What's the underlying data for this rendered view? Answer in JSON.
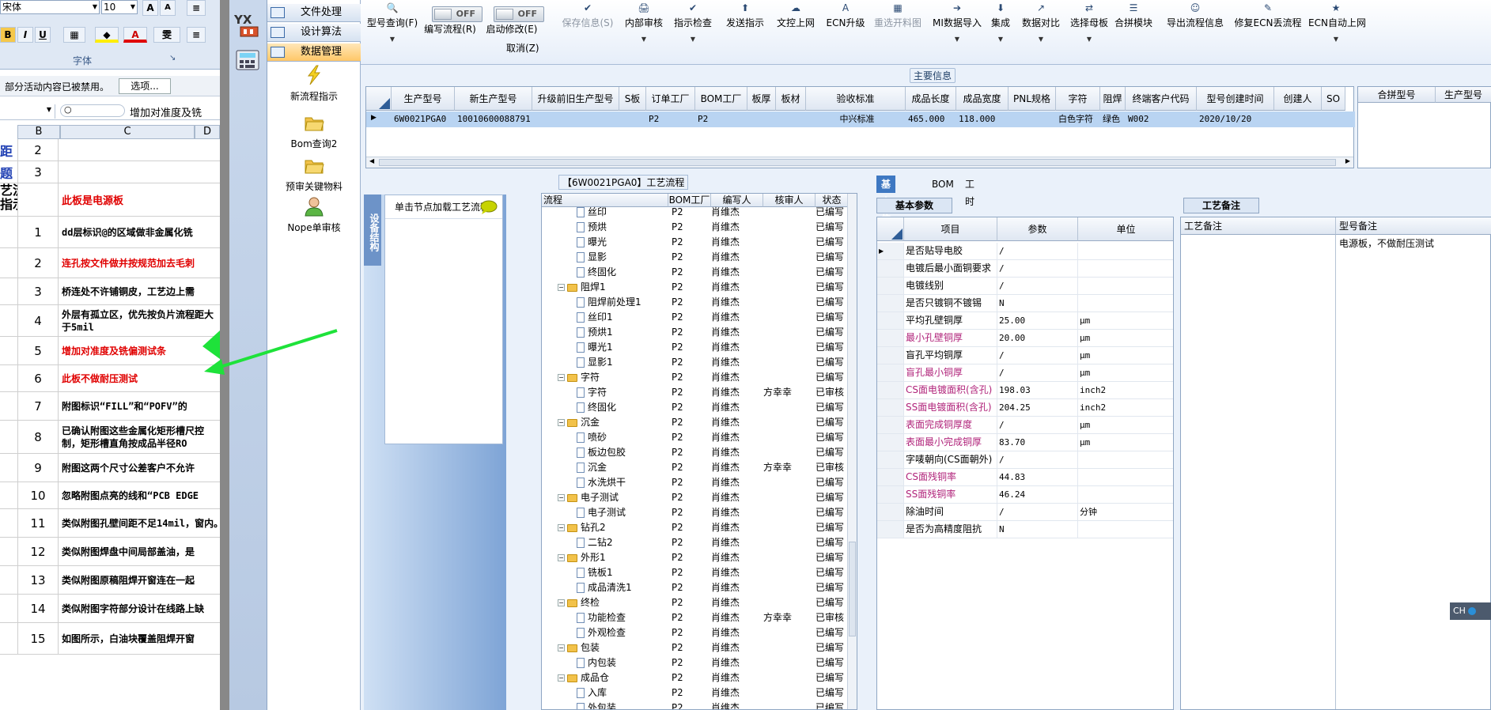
{
  "excel": {
    "font_name": "宋体",
    "font_size": "10",
    "font_group_label": "字体",
    "message": "部分活动内容已被禁用。",
    "options_button": "选项...",
    "formula_text": "增加对准度及铣",
    "col_b": "B",
    "col_c": "C",
    "col_d": "D",
    "left_fragments": [
      "距",
      "题",
      "艺流程",
      "指示"
    ],
    "rows": [
      {
        "num": "2",
        "text": "",
        "red": false
      },
      {
        "num": "3",
        "text": "",
        "red": false
      },
      {
        "num": "",
        "text": "此板是电源板",
        "red": true
      },
      {
        "num": "1",
        "text": "dd层标识@的区域做非金属化铣",
        "red": false
      },
      {
        "num": "2",
        "text": "连孔按文件做并按规范加去毛刺",
        "red": true
      },
      {
        "num": "3",
        "text": "桥连处不许铺铜皮，工艺边上需",
        "red": false
      },
      {
        "num": "4",
        "text": "外层有孤立区，优先按负片流程距大于5mil",
        "red": false
      },
      {
        "num": "5",
        "text": "增加对准度及铣偏测试条",
        "red": true
      },
      {
        "num": "6",
        "text": "此板不做耐压测试",
        "red": true
      },
      {
        "num": "7",
        "text": "附图标识“FILL”和“POFV”的",
        "red": false
      },
      {
        "num": "8",
        "text": "已确认附图这些金属化矩形槽尺控制，矩形槽直角按成品半径RO",
        "red": false
      },
      {
        "num": "9",
        "text": "附图这两个尺寸公差客户不允许",
        "red": false
      },
      {
        "num": "10",
        "text": "忽略附图点亮的线和“PCB EDGE",
        "red": false
      },
      {
        "num": "11",
        "text": "类似附图孔壁间距不足14mil，窗内。",
        "red": false
      },
      {
        "num": "12",
        "text": "类似附图焊盘中间局部盖油，是",
        "red": false
      },
      {
        "num": "13",
        "text": "类似附图原稿阻焊开窗连在一起",
        "red": false
      },
      {
        "num": "14",
        "text": "类似附图字符部分设计在线路上缺",
        "red": false
      },
      {
        "num": "15",
        "text": "如图所示，白油块覆盖阻焊开窗",
        "red": false
      }
    ]
  },
  "modules": {
    "logo": "YX",
    "tabs": [
      "文件处理",
      "设计算法",
      "数据管理"
    ],
    "tools": [
      "新流程指示",
      "Bom查询2",
      "预审关键物料",
      "Nope单审核"
    ]
  },
  "toolbar": {
    "buttons": [
      {
        "label": "型号查询(F)",
        "icon": "🔍",
        "disabled": false,
        "dd": true
      },
      {
        "label": "编写流程(R)",
        "icon": "",
        "disabled": false,
        "dd": false
      },
      {
        "label": "启动修改(E)",
        "icon": "",
        "disabled": false,
        "dd": false
      },
      {
        "label": "保存信息(S)",
        "icon": "✔",
        "disabled": true,
        "dd": false
      },
      {
        "label": "内部审核",
        "icon": "🖨",
        "disabled": false,
        "dd": true
      },
      {
        "label": "指示检查",
        "icon": "✔",
        "disabled": false,
        "dd": true
      },
      {
        "label": "发送指示",
        "icon": "⬆",
        "disabled": false,
        "dd": false
      },
      {
        "label": "文控上网",
        "icon": "☁",
        "disabled": false,
        "dd": false
      },
      {
        "label": "ECN升级",
        "icon": "A",
        "disabled": false,
        "dd": false
      },
      {
        "label": "重选开料图",
        "icon": "▦",
        "disabled": true,
        "dd": false
      },
      {
        "label": "MI数据导入",
        "icon": "➔",
        "disabled": false,
        "dd": true
      },
      {
        "label": "集成",
        "icon": "⬇",
        "disabled": false,
        "dd": true
      },
      {
        "label": "数据对比",
        "icon": "↗",
        "disabled": false,
        "dd": true
      },
      {
        "label": "选择母板",
        "icon": "⇄",
        "disabled": false,
        "dd": true
      },
      {
        "label": "合拼模块",
        "icon": "☰",
        "disabled": false,
        "dd": false
      },
      {
        "label": "导出流程信息",
        "icon": "☺",
        "disabled": false,
        "dd": false
      },
      {
        "label": "修复ECN丢流程",
        "icon": "✎",
        "disabled": false,
        "dd": false
      },
      {
        "label": "ECN自动上网",
        "icon": "★",
        "disabled": false,
        "dd": true
      }
    ],
    "toggle1": "OFF",
    "toggle2": "OFF",
    "cancel_label": "取消(Z)"
  },
  "main_info": {
    "title": "主要信息",
    "headers": [
      "生产型号",
      "新生产型号",
      "升级前旧生产型号",
      "S板",
      "订单工厂",
      "BOM工厂",
      "板厚",
      "板材",
      "验收标准",
      "成品长度",
      "成品宽度",
      "PNL规格",
      "字符",
      "阻焊",
      "终端客户代码",
      "型号创建时间",
      "创建人",
      "SO"
    ],
    "row": [
      "6W0021PGA0",
      "10010600088791",
      "",
      "",
      "P2",
      "P2",
      "",
      "",
      "中兴标准",
      "465.000",
      "118.000",
      "",
      "白色字符",
      "绿色",
      "W002",
      "2020/10/20",
      "",
      ""
    ],
    "side_headers": [
      "合拼型号",
      "生产型号"
    ]
  },
  "process": {
    "title": "【6W0021PGA0】工艺流程",
    "vtab": "设备结构",
    "node_hint": "单击节点加载工艺流程",
    "headers": [
      "流程",
      "BOM工厂",
      "编写人",
      "核审人",
      "状态"
    ],
    "rows": [
      {
        "level": 2,
        "kind": "doc",
        "name": "丝印",
        "bom": "P2",
        "writer": "肖维杰",
        "reviewer": "",
        "status": "已编写"
      },
      {
        "level": 2,
        "kind": "doc",
        "name": "预烘",
        "bom": "P2",
        "writer": "肖维杰",
        "reviewer": "",
        "status": "已编写"
      },
      {
        "level": 2,
        "kind": "doc",
        "name": "曝光",
        "bom": "P2",
        "writer": "肖维杰",
        "reviewer": "",
        "status": "已编写"
      },
      {
        "level": 2,
        "kind": "doc",
        "name": "显影",
        "bom": "P2",
        "writer": "肖维杰",
        "reviewer": "",
        "status": "已编写"
      },
      {
        "level": 2,
        "kind": "doc",
        "name": "终固化",
        "bom": "P2",
        "writer": "肖维杰",
        "reviewer": "",
        "status": "已编写"
      },
      {
        "level": 1,
        "kind": "folder",
        "name": "阻焊1",
        "bom": "P2",
        "writer": "肖维杰",
        "reviewer": "",
        "status": "已编写"
      },
      {
        "level": 2,
        "kind": "doc",
        "name": "阻焊前处理1",
        "bom": "P2",
        "writer": "肖维杰",
        "reviewer": "",
        "status": "已编写"
      },
      {
        "level": 2,
        "kind": "doc",
        "name": "丝印1",
        "bom": "P2",
        "writer": "肖维杰",
        "reviewer": "",
        "status": "已编写"
      },
      {
        "level": 2,
        "kind": "doc",
        "name": "预烘1",
        "bom": "P2",
        "writer": "肖维杰",
        "reviewer": "",
        "status": "已编写"
      },
      {
        "level": 2,
        "kind": "doc",
        "name": "曝光1",
        "bom": "P2",
        "writer": "肖维杰",
        "reviewer": "",
        "status": "已编写"
      },
      {
        "level": 2,
        "kind": "doc",
        "name": "显影1",
        "bom": "P2",
        "writer": "肖维杰",
        "reviewer": "",
        "status": "已编写"
      },
      {
        "level": 1,
        "kind": "folder",
        "name": "字符",
        "bom": "P2",
        "writer": "肖维杰",
        "reviewer": "",
        "status": "已编写"
      },
      {
        "level": 2,
        "kind": "doc",
        "name": "字符",
        "bom": "P2",
        "writer": "肖维杰",
        "reviewer": "方幸幸",
        "status": "已审核"
      },
      {
        "level": 2,
        "kind": "doc",
        "name": "终固化",
        "bom": "P2",
        "writer": "肖维杰",
        "reviewer": "",
        "status": "已编写"
      },
      {
        "level": 1,
        "kind": "folder",
        "name": "沉金",
        "bom": "P2",
        "writer": "肖维杰",
        "reviewer": "",
        "status": "已编写"
      },
      {
        "level": 2,
        "kind": "doc",
        "name": "喷砂",
        "bom": "P2",
        "writer": "肖维杰",
        "reviewer": "",
        "status": "已编写"
      },
      {
        "level": 2,
        "kind": "doc",
        "name": "板边包胶",
        "bom": "P2",
        "writer": "肖维杰",
        "reviewer": "",
        "status": "已编写"
      },
      {
        "level": 2,
        "kind": "doc",
        "name": "沉金",
        "bom": "P2",
        "writer": "肖维杰",
        "reviewer": "方幸幸",
        "status": "已审核"
      },
      {
        "level": 2,
        "kind": "doc",
        "name": "水洗烘干",
        "bom": "P2",
        "writer": "肖维杰",
        "reviewer": "",
        "status": "已编写"
      },
      {
        "level": 1,
        "kind": "folder",
        "name": "电子测试",
        "bom": "P2",
        "writer": "肖维杰",
        "reviewer": "",
        "status": "已编写"
      },
      {
        "level": 2,
        "kind": "doc",
        "name": "电子测试",
        "bom": "P2",
        "writer": "肖维杰",
        "reviewer": "",
        "status": "已编写"
      },
      {
        "level": 1,
        "kind": "folder",
        "name": "钻孔2",
        "bom": "P2",
        "writer": "肖维杰",
        "reviewer": "",
        "status": "已编写"
      },
      {
        "level": 2,
        "kind": "doc",
        "name": "二钻2",
        "bom": "P2",
        "writer": "肖维杰",
        "reviewer": "",
        "status": "已编写"
      },
      {
        "level": 1,
        "kind": "folder",
        "name": "外形1",
        "bom": "P2",
        "writer": "肖维杰",
        "reviewer": "",
        "status": "已编写"
      },
      {
        "level": 2,
        "kind": "doc",
        "name": "铣板1",
        "bom": "P2",
        "writer": "肖维杰",
        "reviewer": "",
        "status": "已编写"
      },
      {
        "level": 2,
        "kind": "doc",
        "name": "成品清洗1",
        "bom": "P2",
        "writer": "肖维杰",
        "reviewer": "",
        "status": "已编写"
      },
      {
        "level": 1,
        "kind": "folder",
        "name": "终检",
        "bom": "P2",
        "writer": "肖维杰",
        "reviewer": "",
        "status": "已编写"
      },
      {
        "level": 2,
        "kind": "doc",
        "name": "功能检查",
        "bom": "P2",
        "writer": "肖维杰",
        "reviewer": "方幸幸",
        "status": "已审核"
      },
      {
        "level": 2,
        "kind": "doc",
        "name": "外观检查",
        "bom": "P2",
        "writer": "肖维杰",
        "reviewer": "",
        "status": "已编写"
      },
      {
        "level": 1,
        "kind": "folder",
        "name": "包装",
        "bom": "P2",
        "writer": "肖维杰",
        "reviewer": "",
        "status": "已编写"
      },
      {
        "level": 2,
        "kind": "doc",
        "name": "内包装",
        "bom": "P2",
        "writer": "肖维杰",
        "reviewer": "",
        "status": "已编写"
      },
      {
        "level": 1,
        "kind": "folder",
        "name": "成品仓",
        "bom": "P2",
        "writer": "肖维杰",
        "reviewer": "",
        "status": "已编写"
      },
      {
        "level": 2,
        "kind": "doc",
        "name": "入库",
        "bom": "P2",
        "writer": "肖维杰",
        "reviewer": "",
        "status": "已编写"
      },
      {
        "level": 2,
        "kind": "doc",
        "name": "外包装",
        "bom": "P2",
        "writer": "肖维杰",
        "reviewer": "",
        "status": "已编写"
      }
    ]
  },
  "basic_info": {
    "tabs": [
      "基本信息",
      "BOM",
      "工时"
    ],
    "title": "基本参数",
    "headers": [
      "项目",
      "参数",
      "单位"
    ],
    "rows": [
      {
        "item": "是否贴导电胶",
        "value": "/",
        "unit": "",
        "purple": false
      },
      {
        "item": "电镀后最小面铜要求",
        "value": "/",
        "unit": "",
        "purple": false
      },
      {
        "item": "电镀线别",
        "value": "/",
        "unit": "",
        "purple": false
      },
      {
        "item": "是否只镀铜不镀锡",
        "value": "N",
        "unit": "",
        "purple": false
      },
      {
        "item": "平均孔壁铜厚",
        "value": "25.00",
        "unit": "μm",
        "purple": false
      },
      {
        "item": "最小孔壁铜厚",
        "value": "20.00",
        "unit": "μm",
        "purple": true
      },
      {
        "item": "盲孔平均铜厚",
        "value": "/",
        "unit": "μm",
        "purple": false
      },
      {
        "item": "盲孔最小铜厚",
        "value": "/",
        "unit": "μm",
        "purple": true
      },
      {
        "item": "CS面电镀面积(含孔)",
        "value": "198.03",
        "unit": "inch2",
        "purple": true
      },
      {
        "item": "SS面电镀面积(含孔)",
        "value": "204.25",
        "unit": "inch2",
        "purple": true
      },
      {
        "item": "表面完成铜厚度",
        "value": "/",
        "unit": "μm",
        "purple": true
      },
      {
        "item": "表面最小完成铜厚",
        "value": "83.70",
        "unit": "μm",
        "purple": true
      },
      {
        "item": "字唛朝向(CS面朝外)",
        "value": "/",
        "unit": "",
        "purple": false
      },
      {
        "item": "CS面残铜率",
        "value": "44.83",
        "unit": "",
        "purple": true
      },
      {
        "item": "SS面残铜率",
        "value": "46.24",
        "unit": "",
        "purple": true
      },
      {
        "item": "除油时间",
        "value": "/",
        "unit": "分钟",
        "purple": false
      },
      {
        "item": "是否为高精度阻抗",
        "value": "N",
        "unit": "",
        "purple": false
      }
    ]
  },
  "notes": {
    "title": "工艺备注",
    "headers": [
      "工艺备注",
      "型号备注"
    ],
    "model_note": "电源板，不做耐压测试"
  },
  "ime": "CH"
}
